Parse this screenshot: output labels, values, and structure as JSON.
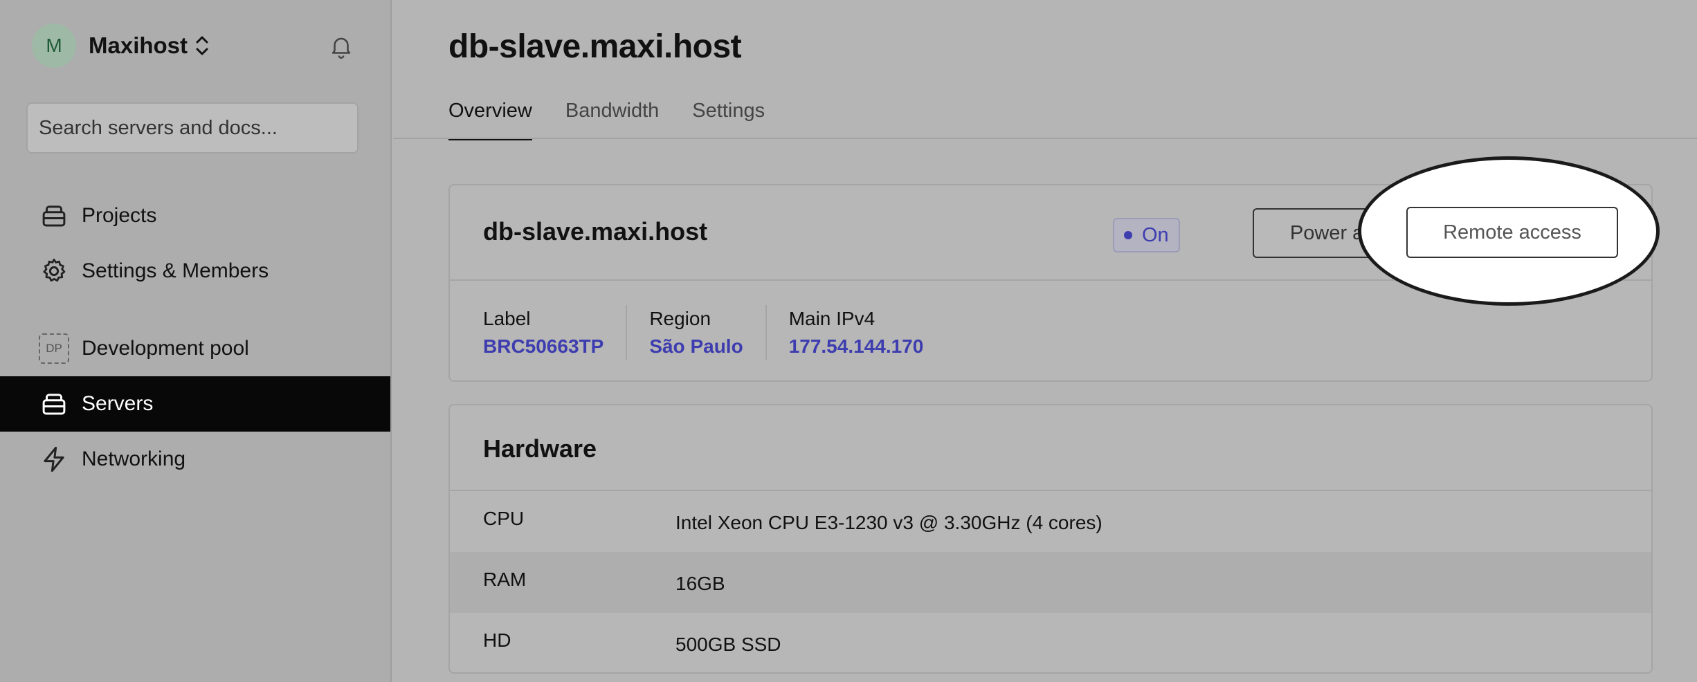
{
  "sidebar": {
    "org_initial": "M",
    "org_name": "Maxihost",
    "search_placeholder": "Search servers and docs...",
    "items": [
      {
        "label": "Projects",
        "icon": "stack-icon"
      },
      {
        "label": "Settings & Members",
        "icon": "gear-icon"
      },
      {
        "label": "Development pool",
        "icon": "dp-badge",
        "badge": "DP"
      },
      {
        "label": "Servers",
        "icon": "stack-icon",
        "active": true
      },
      {
        "label": "Networking",
        "icon": "bolt-icon"
      }
    ]
  },
  "header": {
    "title": "db-slave.maxi.host",
    "tabs": [
      "Overview",
      "Bandwidth",
      "Settings"
    ]
  },
  "server_card": {
    "title": "db-slave.maxi.host",
    "status": "On",
    "power_button": "Power actions",
    "remote_button": "Remote access",
    "meta": [
      {
        "label": "Label",
        "value": "BRC50663TP"
      },
      {
        "label": "Region",
        "value": "São Paulo"
      },
      {
        "label": "Main IPv4",
        "value": "177.54.144.170"
      }
    ]
  },
  "hardware": {
    "title": "Hardware",
    "rows": [
      {
        "key": "CPU",
        "value": "Intel Xeon CPU E3-1230 v3 @ 3.30GHz (4 cores)"
      },
      {
        "key": "RAM",
        "value": "16GB"
      },
      {
        "key": "HD",
        "value": "500GB SSD"
      }
    ]
  },
  "colors": {
    "accent": "#3d3db0",
    "active_nav_bg": "#080808"
  }
}
